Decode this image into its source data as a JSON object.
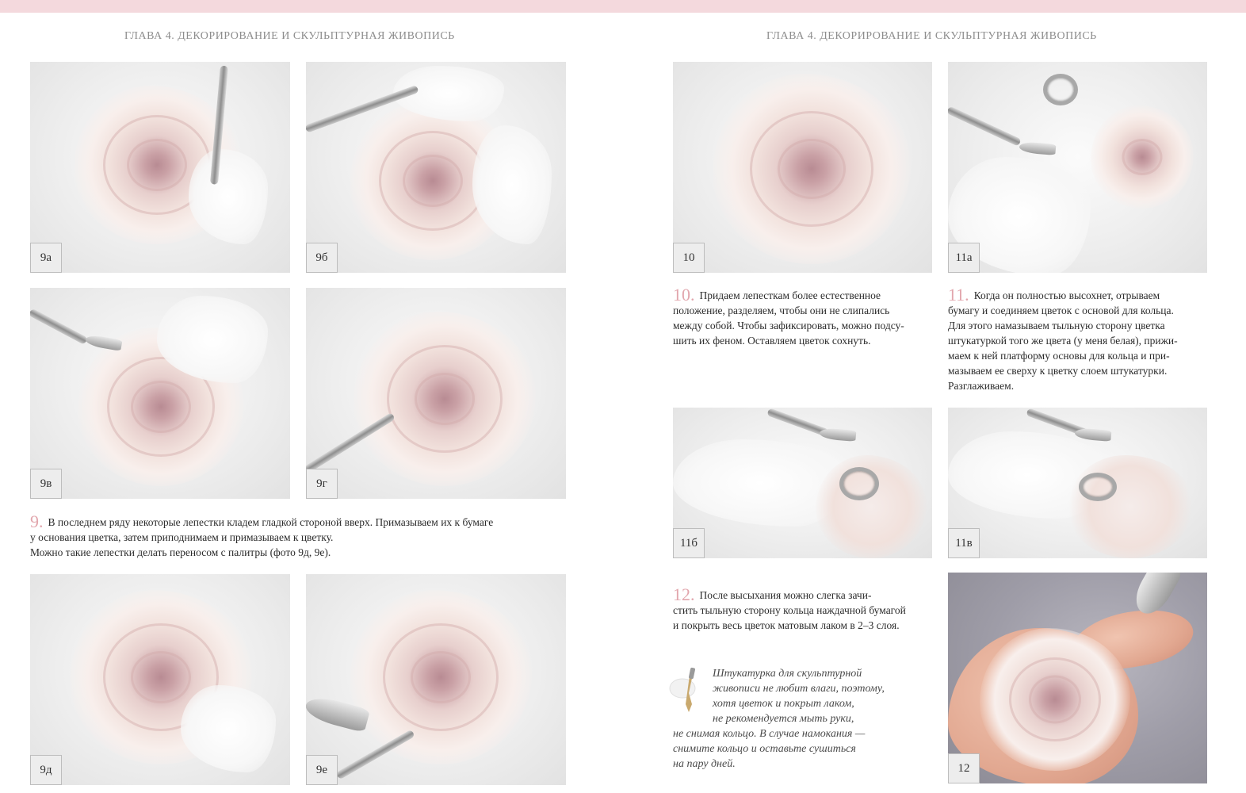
{
  "header": {
    "left": "ГЛАВА 4. ДЕКОРИРОВАНИЕ И СКУЛЬПТУРНАЯ ЖИВОПИСЬ",
    "right": "ГЛАВА 4. ДЕКОРИРОВАНИЕ И СКУЛЬПТУРНАЯ ЖИВОПИСЬ"
  },
  "photos": {
    "p9a": "9а",
    "p9b": "9б",
    "p9v": "9в",
    "p9g": "9г",
    "p9d": "9д",
    "p9e": "9е",
    "p10": "10",
    "p11a": "11а",
    "p11b": "11б",
    "p11v": "11в",
    "p12": "12"
  },
  "steps": {
    "s9": {
      "num": "9.",
      "lines": [
        "В последнем ряду некоторые лепестки кладем гладкой стороной вверх. Примазываем их к бумаге",
        "у основания цветка, затем приподнимаем и примазываем к цветку.",
        "Можно такие лепестки делать переносом с палитры (фото 9д, 9е)."
      ]
    },
    "s10": {
      "num": "10.",
      "lines": [
        "Придаем лепесткам более естественное",
        "положение, разделяем, чтобы они не слипались",
        "между собой. Чтобы зафиксировать, можно подсу-",
        "шить их феном. Оставляем цветок сохнуть."
      ]
    },
    "s11": {
      "num": "11.",
      "lines": [
        "Когда он полностью высохнет, отрываем",
        "бумагу и соединяем цветок с основой для кольца.",
        "Для этого намазываем тыльную сторону цветка",
        "штукатуркой того же цвета (у меня белая), прижи-",
        "маем к ней платформу основы для кольца и при-",
        "мазываем ее сверху к цветку слоем штукатурки.",
        "Разглаживаем."
      ]
    },
    "s12": {
      "num": "12.",
      "lines": [
        "После высыхания можно слегка зачи-",
        "стить тыльную сторону кольца наждачной бумагой",
        "и покрыть весь цветок матовым лаком в 2–3 слоя."
      ]
    }
  },
  "note": {
    "lines": [
      "Штукатурка для скульптурной",
      "живописи не любит влаги, поэтому,",
      "хотя цветок и покрыт лаком,",
      "не рекомендуется мыть руки,",
      "не снимая кольцо. В случае намокания —",
      "снимите кольцо и оставьте сушиться",
      "на пару дней."
    ]
  },
  "colors": {
    "accent": "#e2a6ad",
    "top_band": "#f4d9dd",
    "header_text": "#8d8d8d"
  },
  "icons": {
    "note_icon": "palette-knife-icon"
  }
}
